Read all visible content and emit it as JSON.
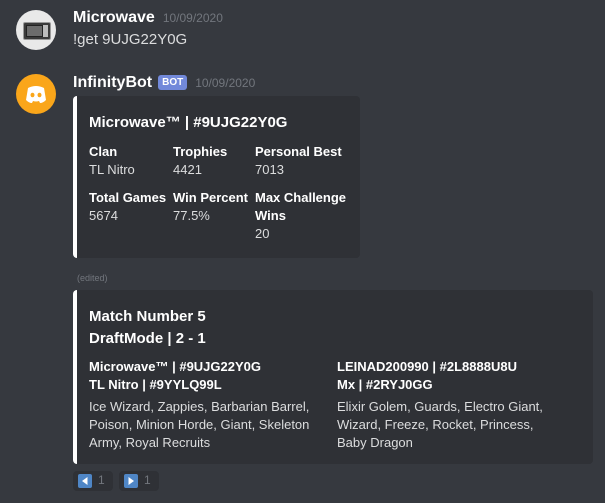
{
  "message1": {
    "username": "Microwave",
    "timestamp": "10/09/2020",
    "content": "!get 9UJG22Y0G"
  },
  "message2": {
    "username": "InfinityBot",
    "bot_tag": "BOT",
    "timestamp": "10/09/2020",
    "embed": {
      "title": "Microwave™ | #9UJG22Y0G",
      "fields": [
        {
          "name": "Clan",
          "value": "TL Nitro"
        },
        {
          "name": "Trophies",
          "value": "4421"
        },
        {
          "name": "Personal Best",
          "value": "7013"
        },
        {
          "name": "Total Games",
          "value": "5674"
        },
        {
          "name": "Win Percent",
          "value": "77.5%"
        },
        {
          "name": "Max Challenge Wins",
          "value": "20"
        }
      ]
    }
  },
  "edited_label": "(edited)",
  "embed2": {
    "title_line1": "Match Number 5",
    "title_line2": "DraftMode | 2 - 1",
    "player1": {
      "name": "Microwave™ | #9UJG22Y0G",
      "clan": "TL Nitro | #9YYLQ99L",
      "deck": "Ice Wizard, Zappies, Barbarian Barrel, Poison, Minion Horde, Giant, Skeleton Army, Royal Recruits"
    },
    "player2": {
      "name": "LEINAD200990 | #2L8888U8U",
      "clan": "Mx | #2RYJ0GG",
      "deck": "Elixir Golem, Guards, Electro Giant, Wizard, Freeze, Rocket, Princess, Baby Dragon"
    }
  },
  "reactions": [
    {
      "icon": "arrow-left-icon",
      "count": "1"
    },
    {
      "icon": "arrow-right-icon",
      "count": "1"
    }
  ],
  "colors": {
    "background": "#36393f",
    "embed_bg": "#2f3136",
    "embed_border": "#ffffff",
    "bot_avatar": "#faa61a",
    "bot_tag": "#7289da",
    "reaction_arrow": "#4f86c6"
  }
}
